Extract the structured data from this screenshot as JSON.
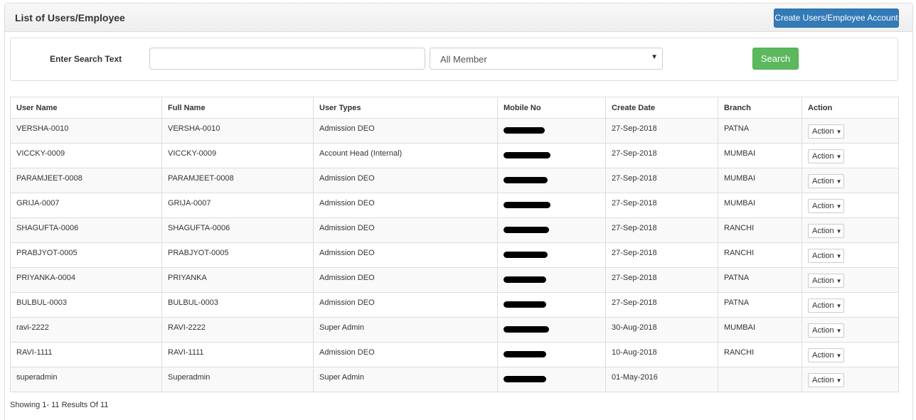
{
  "header": {
    "title": "List of Users/Employee",
    "create_button_label": "Create Users/Employee Account"
  },
  "search": {
    "label": "Enter Search Text",
    "input_value": "",
    "member_select_value": "All Member",
    "button_label": "Search"
  },
  "table": {
    "columns": [
      "User Name",
      "Full Name",
      "User Types",
      "Mobile No",
      "Create Date",
      "Branch",
      "Action"
    ],
    "rows": [
      {
        "user_name": "VERSHA-0010",
        "full_name": "VERSHA-0010",
        "user_type": "Admission DEO",
        "create_date": "27-Sep-2018",
        "branch": "PATNA",
        "action": "Action"
      },
      {
        "user_name": "VICCKY-0009",
        "full_name": "VICCKY-0009",
        "user_type": "Account Head (Internal)",
        "create_date": "27-Sep-2018",
        "branch": "MUMBAI",
        "action": "Action"
      },
      {
        "user_name": "PARAMJEET-0008",
        "full_name": "PARAMJEET-0008",
        "user_type": "Admission DEO",
        "create_date": "27-Sep-2018",
        "branch": "MUMBAI",
        "action": "Action"
      },
      {
        "user_name": "GRIJA-0007",
        "full_name": "GRIJA-0007",
        "user_type": "Admission DEO",
        "create_date": "27-Sep-2018",
        "branch": "MUMBAI",
        "action": "Action"
      },
      {
        "user_name": "SHAGUFTA-0006",
        "full_name": "SHAGUFTA-0006",
        "user_type": "Admission DEO",
        "create_date": "27-Sep-2018",
        "branch": "RANCHI",
        "action": "Action"
      },
      {
        "user_name": "PRABJYOT-0005",
        "full_name": "PRABJYOT-0005",
        "user_type": "Admission DEO",
        "create_date": "27-Sep-2018",
        "branch": "RANCHI",
        "action": "Action"
      },
      {
        "user_name": "PRIYANKA-0004",
        "full_name": "PRIYANKA",
        "user_type": "Admission DEO",
        "create_date": "27-Sep-2018",
        "branch": "PATNA",
        "action": "Action"
      },
      {
        "user_name": "BULBUL-0003",
        "full_name": "BULBUL-0003",
        "user_type": "Admission DEO",
        "create_date": "27-Sep-2018",
        "branch": "PATNA",
        "action": "Action"
      },
      {
        "user_name": "ravi-2222",
        "full_name": "RAVI-2222",
        "user_type": "Super Admin",
        "create_date": "30-Aug-2018",
        "branch": "MUMBAI",
        "action": "Action"
      },
      {
        "user_name": "RAVI-1111",
        "full_name": "RAVI-1111",
        "user_type": "Admission DEO",
        "create_date": "10-Aug-2018",
        "branch": "RANCHI",
        "action": "Action"
      },
      {
        "user_name": "superadmin",
        "full_name": "Superadmin",
        "user_type": "Super Admin",
        "create_date": "01-May-2016",
        "branch": "",
        "action": "Action"
      }
    ]
  },
  "footer": {
    "results_text": "Showing 1- 11 Results Of 11"
  },
  "colors": {
    "primary": "#337ab7",
    "success": "#5cb85c"
  }
}
